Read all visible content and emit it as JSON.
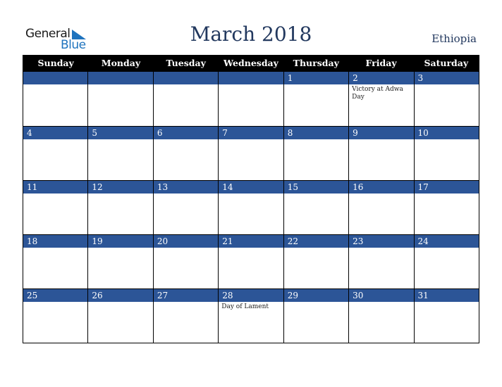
{
  "logo": {
    "line1": "General",
    "line2": "Blue"
  },
  "title": "March 2018",
  "country": "Ethiopia",
  "weekdays": [
    "Sunday",
    "Monday",
    "Tuesday",
    "Wednesday",
    "Thursday",
    "Friday",
    "Saturday"
  ],
  "weeks": [
    [
      {
        "d": "",
        "e": ""
      },
      {
        "d": "",
        "e": ""
      },
      {
        "d": "",
        "e": ""
      },
      {
        "d": "",
        "e": ""
      },
      {
        "d": "1",
        "e": ""
      },
      {
        "d": "2",
        "e": "Victory at Adwa Day"
      },
      {
        "d": "3",
        "e": ""
      }
    ],
    [
      {
        "d": "4",
        "e": ""
      },
      {
        "d": "5",
        "e": ""
      },
      {
        "d": "6",
        "e": ""
      },
      {
        "d": "7",
        "e": ""
      },
      {
        "d": "8",
        "e": ""
      },
      {
        "d": "9",
        "e": ""
      },
      {
        "d": "10",
        "e": ""
      }
    ],
    [
      {
        "d": "11",
        "e": ""
      },
      {
        "d": "12",
        "e": ""
      },
      {
        "d": "13",
        "e": ""
      },
      {
        "d": "14",
        "e": ""
      },
      {
        "d": "15",
        "e": ""
      },
      {
        "d": "16",
        "e": ""
      },
      {
        "d": "17",
        "e": ""
      }
    ],
    [
      {
        "d": "18",
        "e": ""
      },
      {
        "d": "19",
        "e": ""
      },
      {
        "d": "20",
        "e": ""
      },
      {
        "d": "21",
        "e": ""
      },
      {
        "d": "22",
        "e": ""
      },
      {
        "d": "23",
        "e": ""
      },
      {
        "d": "24",
        "e": ""
      }
    ],
    [
      {
        "d": "25",
        "e": ""
      },
      {
        "d": "26",
        "e": ""
      },
      {
        "d": "27",
        "e": ""
      },
      {
        "d": "28",
        "e": "Day of Lament"
      },
      {
        "d": "29",
        "e": ""
      },
      {
        "d": "30",
        "e": ""
      },
      {
        "d": "31",
        "e": ""
      }
    ]
  ]
}
